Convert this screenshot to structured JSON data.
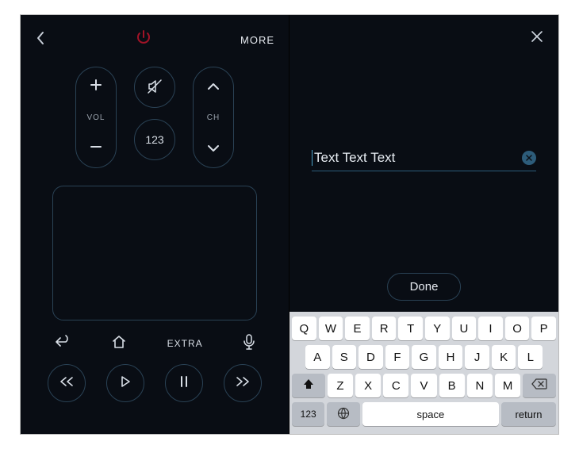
{
  "left": {
    "more": "MORE",
    "vol_label": "VOL",
    "ch_label": "CH",
    "numpad_label": "123",
    "extra_label": "EXTRA"
  },
  "right": {
    "input_text": "Text Text Text",
    "done_label": "Done"
  },
  "keyboard": {
    "row1": [
      "Q",
      "W",
      "E",
      "R",
      "T",
      "Y",
      "U",
      "I",
      "O",
      "P"
    ],
    "row2": [
      "A",
      "S",
      "D",
      "F",
      "G",
      "H",
      "J",
      "K",
      "L"
    ],
    "row3": [
      "Z",
      "X",
      "C",
      "V",
      "B",
      "N",
      "M"
    ],
    "num_key": "123",
    "space_label": "space",
    "return_label": "return"
  }
}
